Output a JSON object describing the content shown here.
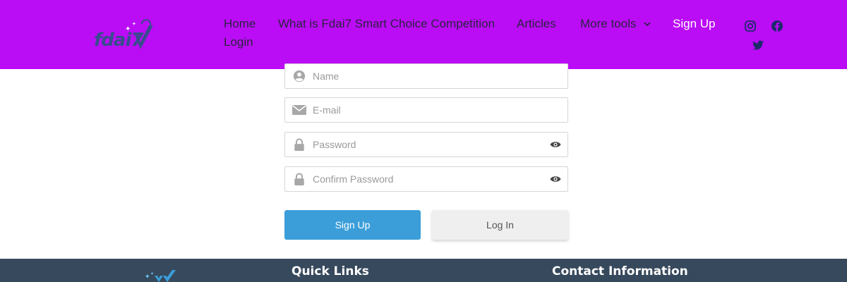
{
  "logo": {
    "text": "fdai7",
    "alt": "Fdai7 logo"
  },
  "nav": {
    "items": [
      {
        "label": "Home"
      },
      {
        "label": "What is Fdai7 Smart Choice Competition"
      },
      {
        "label": "Articles"
      },
      {
        "label": "More tools"
      },
      {
        "label": "Sign Up"
      },
      {
        "label": "Login"
      }
    ]
  },
  "social": {
    "icons": [
      "instagram-icon",
      "facebook-icon",
      "twitter-icon"
    ]
  },
  "form": {
    "name_placeholder": "Name",
    "email_placeholder": "E-mail",
    "password_placeholder": "Password",
    "confirm_placeholder": "Confirm Password",
    "signup_label": "Sign Up",
    "login_label": "Log In"
  },
  "footer": {
    "quick_links_title": "Quick Links",
    "contact_title": "Contact Information"
  },
  "colors": {
    "header_bg": "#bb0cf6",
    "primary_button": "#3b9ed9",
    "footer_bg": "#37495c"
  }
}
